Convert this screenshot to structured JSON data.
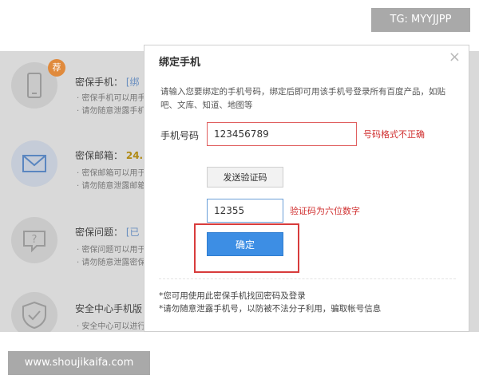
{
  "background_page": {
    "items": [
      {
        "icon": "phone-icon",
        "badge": "荐",
        "title": "密保手机：",
        "title_extra": "[绑",
        "lines": [
          "· 密保手机可以用手",
          "· 请勿随意泄露手机"
        ]
      },
      {
        "icon": "mail-icon",
        "title": "密保邮箱：",
        "title_extra": "24.",
        "lines": [
          "· 密保邮箱可以用于",
          "· 请勿随意泄露邮箱信月"
        ]
      },
      {
        "icon": "question-icon",
        "title": "密保问题：",
        "title_extra": "[已",
        "lines": [
          "· 密保问题可以用于",
          "· 请勿随意泄露密保"
        ]
      },
      {
        "icon": "shield-icon",
        "title": "安全中心手机版",
        "title_extra": "",
        "lines": [
          "· 安全中心可以进行"
        ]
      }
    ]
  },
  "dialog": {
    "title": "绑定手机",
    "close": "×",
    "description": "请输入您要绑定的手机号码，绑定后即可用该手机号登录所有百度产品，如贴吧、文库、知道、地图等",
    "phone_label": "手机号码",
    "phone_value": "123456789",
    "phone_error": "号码格式不正确",
    "send_code_button": "发送验证码",
    "code_value": "12355",
    "code_error": "验证码为六位数字",
    "confirm_button": "确定",
    "notes": [
      "*您可用使用此密保手机找回密码及登录",
      "*请勿随意泄露手机号，以防被不法分子利用，骗取帐号信息"
    ]
  },
  "watermarks": {
    "top": "TG: MYYJJPP",
    "bottom": "www.shoujikaifa.com"
  },
  "colors": {
    "error": "#d03030",
    "highlight": "#d83c3c",
    "primary_button": "#3d8ee4",
    "badge": "#e08a3c"
  }
}
